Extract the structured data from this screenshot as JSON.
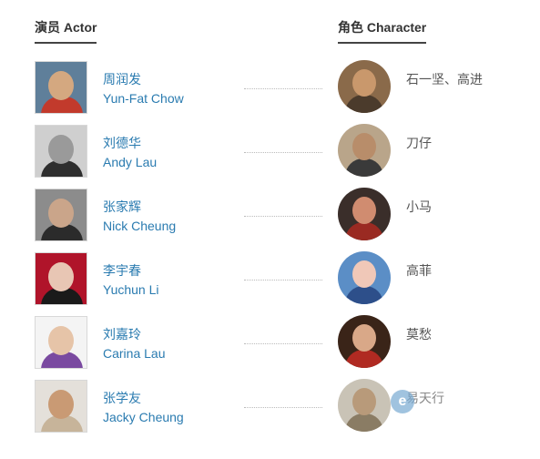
{
  "headers": {
    "actor": "演员 Actor",
    "character": "角色 Character"
  },
  "cast": [
    {
      "actor_zh": "周润发",
      "actor_en": "Yun-Fat Chow",
      "role": "石一坚、高进"
    },
    {
      "actor_zh": "刘德华",
      "actor_en": "Andy Lau",
      "role": "刀仔"
    },
    {
      "actor_zh": "张家辉",
      "actor_en": "Nick Cheung",
      "role": "小马"
    },
    {
      "actor_zh": "李宇春",
      "actor_en": "Yuchun Li",
      "role": "高菲"
    },
    {
      "actor_zh": "刘嘉玲",
      "actor_en": "Carina Lau",
      "role": "莫愁"
    },
    {
      "actor_zh": "张学友",
      "actor_en": "Jacky Cheung",
      "role": "易天行"
    }
  ],
  "colors": {
    "link": "#2a7bb0",
    "role_text": "#555555",
    "header_text": "#333333"
  }
}
